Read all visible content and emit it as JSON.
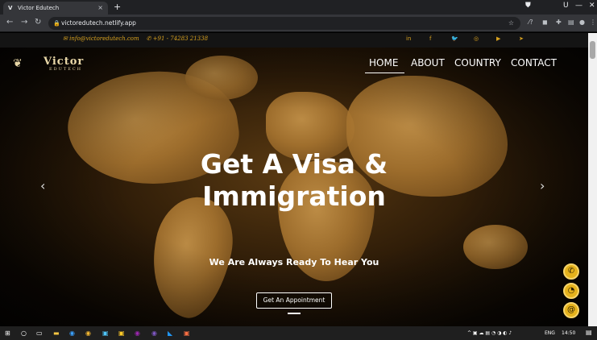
{
  "browser": {
    "tab_title": "Victor Edutech",
    "tab_favicon": "V",
    "url": "victoredutech.netlify.app",
    "controls": {
      "minimize": "—",
      "close": "✕",
      "user": "U"
    }
  },
  "topbar": {
    "email": "info@victoredutech.com",
    "phone": "+91 - 74283 21338",
    "social_icons": [
      "linkedin-icon",
      "facebook-icon",
      "twitter-icon",
      "instagram-icon",
      "youtube-icon",
      "telegram-icon"
    ],
    "accent": "#d9a21f"
  },
  "logo": {
    "name": "Victor",
    "sub": "EDUTECH"
  },
  "nav": {
    "items": [
      "HOME",
      "ABOUT",
      "COUNTRY",
      "CONTACT"
    ],
    "active": "HOME"
  },
  "hero": {
    "headline_line1": "Get A Visa &",
    "headline_line2": "Immigration",
    "tagline": "We Are Always Ready To Hear You",
    "cta": "Get An Appointment"
  },
  "floating_buttons": [
    "phone-icon",
    "whatsapp-icon",
    "email-icon"
  ],
  "taskbar": {
    "lang": "ENG",
    "time": "14:50"
  }
}
